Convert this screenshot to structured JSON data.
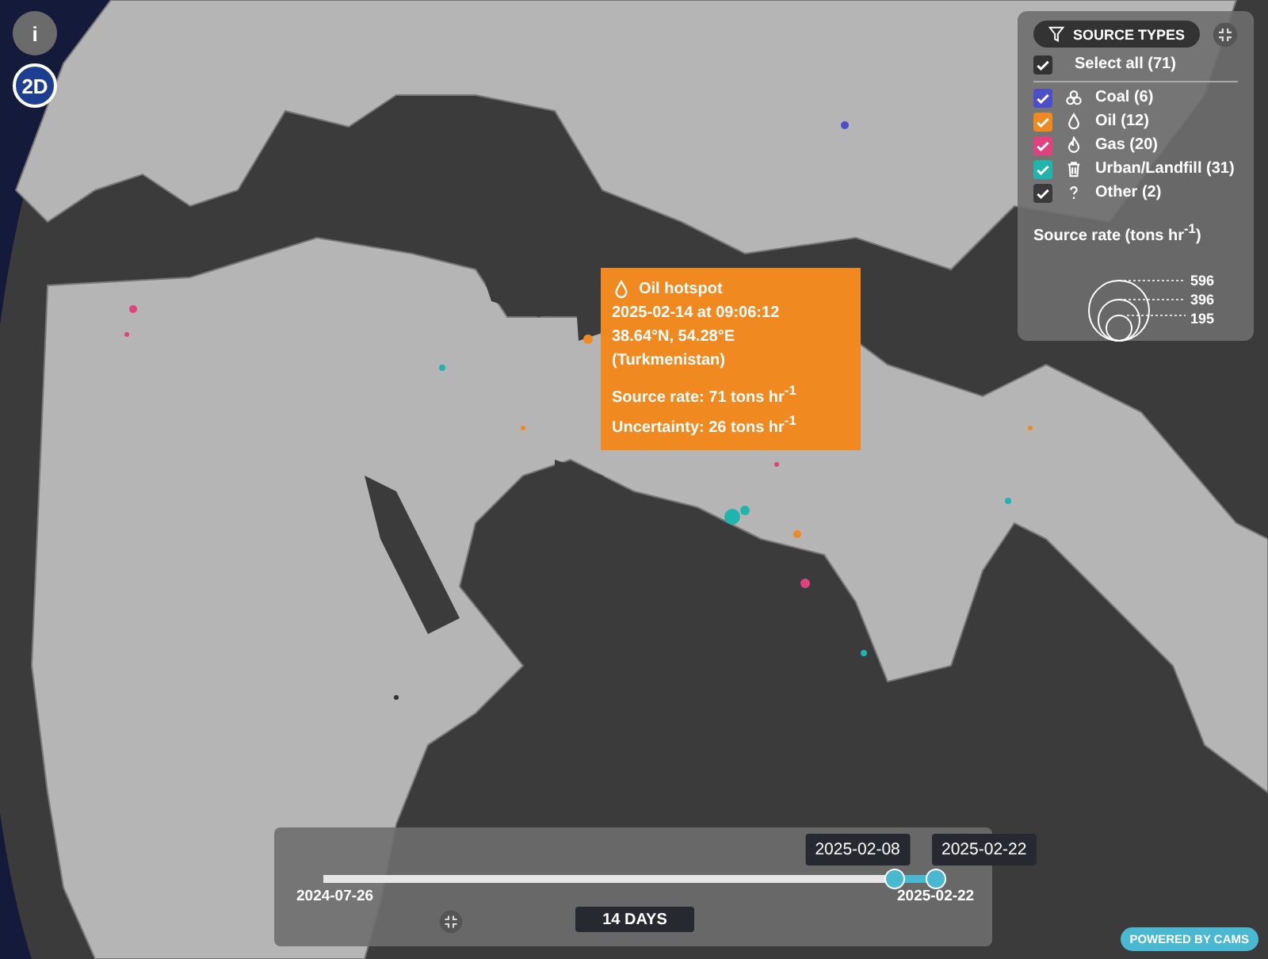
{
  "map_controls": [
    {
      "kind": "info",
      "label": "i"
    },
    {
      "kind": "view",
      "label": "2D"
    }
  ],
  "legend": {
    "title": "SOURCE TYPES",
    "select_all": {
      "label": "Select all (71)",
      "checked": true
    },
    "types": [
      {
        "kind": "coal",
        "label": "Coal (6)",
        "checked": true,
        "color": "#4b4fc9"
      },
      {
        "kind": "oil",
        "label": "Oil (12)",
        "checked": true,
        "color": "#f0891f"
      },
      {
        "kind": "gas",
        "label": "Gas (20)",
        "checked": true,
        "color": "#e0427e"
      },
      {
        "kind": "urban",
        "label": "Urban/Landfill (31)",
        "checked": true,
        "color": "#1fb5ac"
      },
      {
        "kind": "other",
        "label": "Other (2)",
        "checked": true,
        "color": "#3a3a3a"
      }
    ],
    "rate_title": "Source rate (tons hr$^{-1}$)",
    "rate_values": [
      "596",
      "396",
      "195"
    ]
  },
  "tooltip": {
    "title": "Oil hotspot",
    "datetime": "2025-02-14 at 09:06:12",
    "location": "38.64°N, 54.28°E (Turkmenistan)",
    "source_rate": "Source rate: 71 tons hr$^{-1}$",
    "uncertainty": "Uncertainty: 26 tons hr$^{-1}$"
  },
  "timeline": {
    "start": "2024-07-26",
    "end": "2025-02-22",
    "thumbs": [
      {
        "label": "2025-02-08",
        "level": 0.935
      },
      {
        "label": "2025-02-22",
        "level": 1
      }
    ],
    "duration": "14 DAYS"
  },
  "credit": "POWERED BY CAMS"
}
